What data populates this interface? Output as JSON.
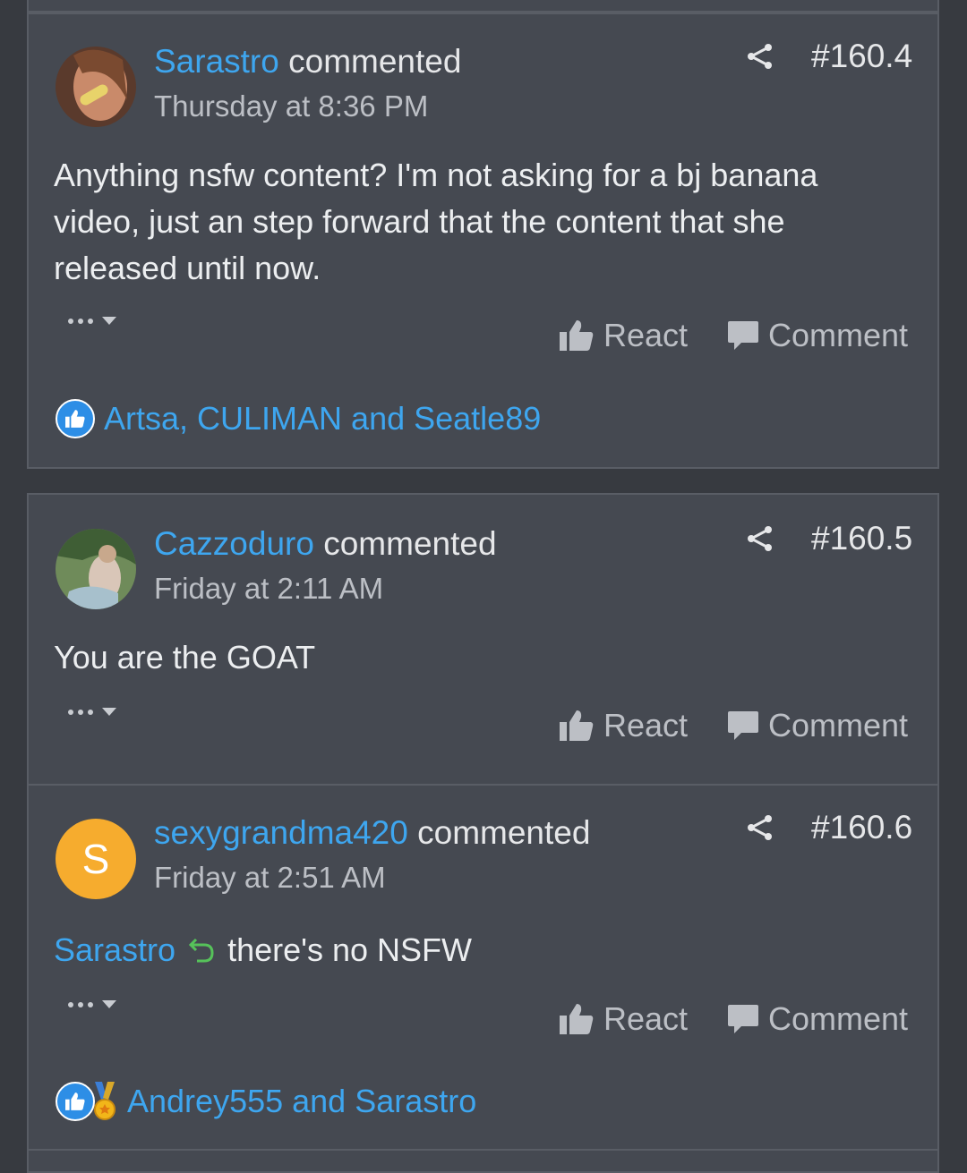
{
  "posts": [
    {
      "username": "Sarastro",
      "verb": " commented",
      "time": "Thursday at 8:36 PM",
      "number": "#160.4",
      "body": "Anything nsfw content? I'm not asking for a bj banana video, just an step forward that the content that she released until now.",
      "react_label": "React",
      "comment_label": "Comment",
      "reactions": "Artsa, CULIMAN and Seatle89"
    },
    {
      "username": "Cazzoduro",
      "verb": " commented",
      "time": "Friday at 2:11 AM",
      "number": "#160.5",
      "body": "You are the GOAT",
      "react_label": "React",
      "comment_label": "Comment"
    },
    {
      "username": "sexygrandma420",
      "verb": " commented",
      "avatar_letter": "S",
      "time": "Friday at 2:51 AM",
      "number": "#160.6",
      "quote_user": "Sarastro",
      "body": "there's no NSFW",
      "react_label": "React",
      "comment_label": "Comment",
      "reactions": "Andrey555 and Sarastro"
    }
  ],
  "colors": {
    "link": "#3ea6ef",
    "card_bg": "#454951",
    "page_bg": "#373a40",
    "avatar_letter_bg": "#f6ac2e"
  }
}
